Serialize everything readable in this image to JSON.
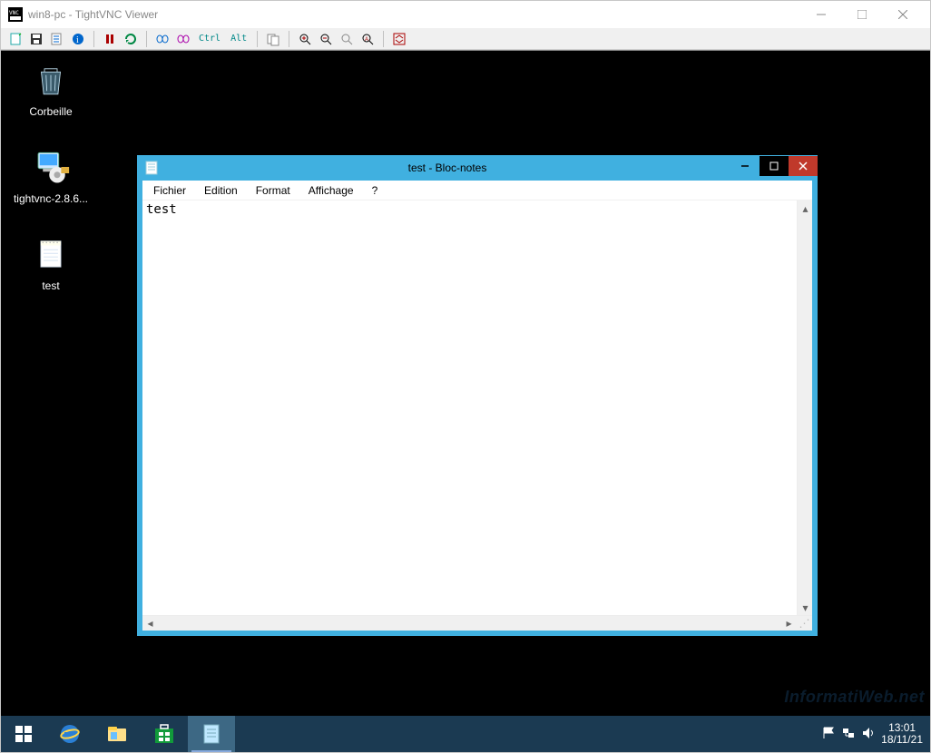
{
  "viewer": {
    "title": "win8-pc - TightVNC Viewer",
    "toolbar": {
      "ctrl_label": "Ctrl",
      "alt_label": "Alt"
    }
  },
  "desktop": {
    "icons": [
      {
        "name": "Corbeille"
      },
      {
        "name": "tightvnc-2.8.6..."
      },
      {
        "name": "test"
      }
    ]
  },
  "notepad": {
    "title": "test - Bloc-notes",
    "menus": [
      "Fichier",
      "Edition",
      "Format",
      "Affichage",
      "?"
    ],
    "content": "test"
  },
  "taskbar": {
    "clock_time": "13:01",
    "clock_date": "18/11/21"
  },
  "watermark": "InformatiWeb.net"
}
